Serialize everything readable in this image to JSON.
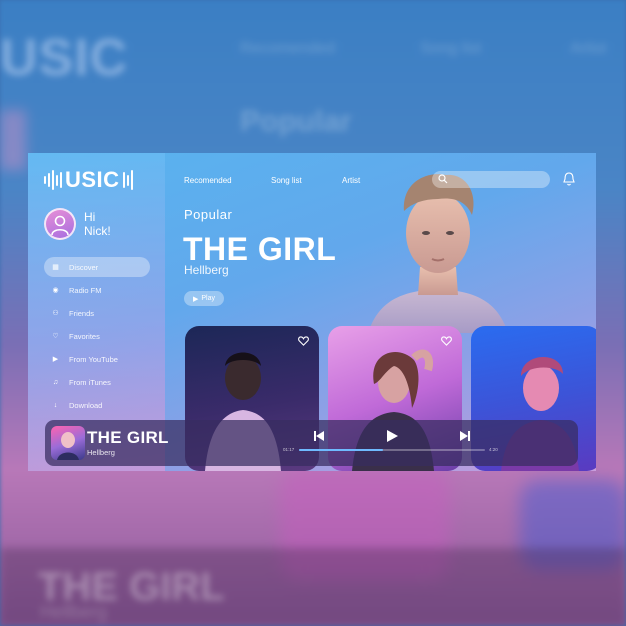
{
  "app": {
    "logo_text": "USIC",
    "greeting_line1": "Hi",
    "greeting_line2": "Nick!"
  },
  "sidebar": {
    "items": [
      {
        "label": "Discover",
        "icon": "grid-icon",
        "active": true
      },
      {
        "label": "Radio FM",
        "icon": "radio-icon",
        "active": false
      },
      {
        "label": "Friends",
        "icon": "friends-icon",
        "active": false
      },
      {
        "label": "Favorites",
        "icon": "heart-icon",
        "active": false
      },
      {
        "label": "From YouTube",
        "icon": "youtube-icon",
        "active": false
      },
      {
        "label": "From iTunes",
        "icon": "itunes-icon",
        "active": false
      },
      {
        "label": "Download",
        "icon": "download-icon",
        "active": false
      }
    ]
  },
  "topnav": {
    "items": [
      "Recomended",
      "Song list",
      "Artist"
    ]
  },
  "hero": {
    "section": "Popular",
    "title": "THE GIRL",
    "artist": "Hellberg",
    "play_label": "Play"
  },
  "player": {
    "title": "THE GIRL",
    "artist": "Hellberg",
    "time_elapsed": "01:17",
    "time_total": "4:20",
    "progress": 0.45
  },
  "backdrop": {
    "logo_text": "USIC",
    "nav": [
      "Recomended",
      "Song list",
      "Artist"
    ],
    "section": "Popular",
    "title": "THE GIRL",
    "artist": "Hellberg"
  },
  "colors": {
    "accent": "#6fbaff",
    "player_bg": "#372d5f"
  }
}
